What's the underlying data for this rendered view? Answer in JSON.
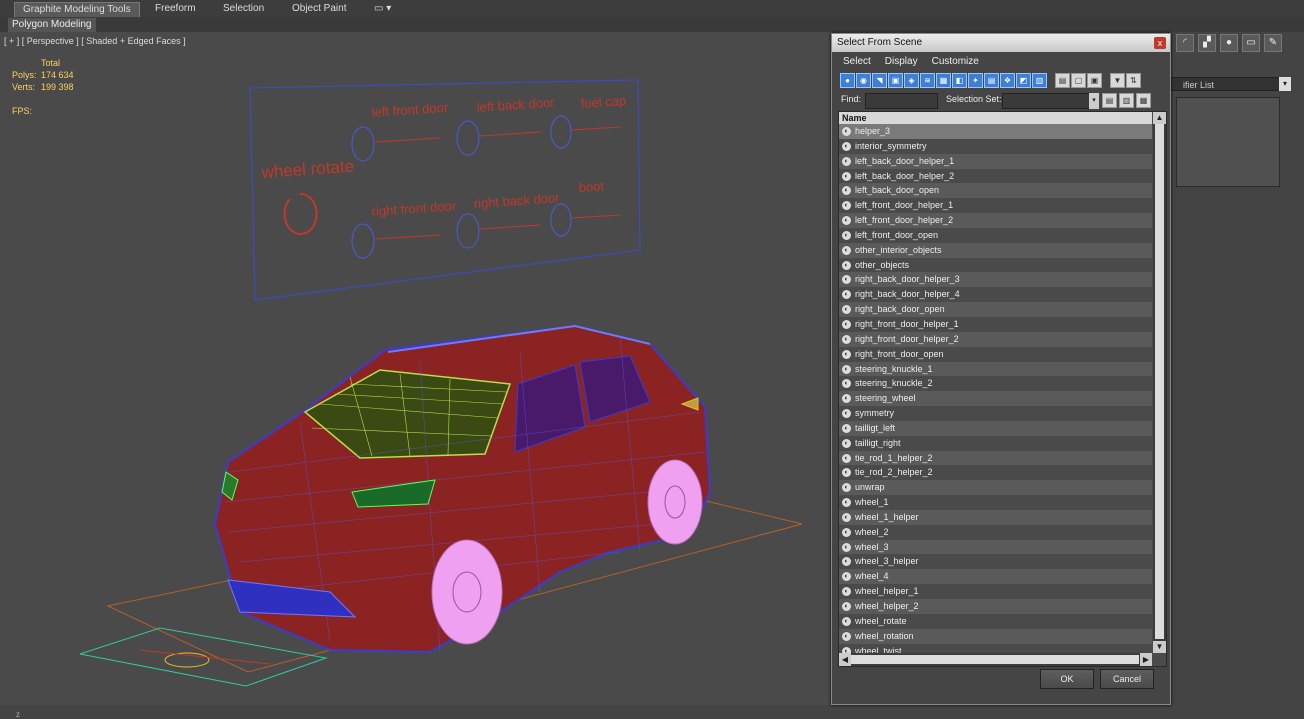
{
  "ribbon": {
    "tabs": [
      "Graphite Modeling Tools",
      "Freeform",
      "Selection",
      "Object Paint"
    ],
    "subtab": "Polygon Modeling"
  },
  "viewport": {
    "label": "[ + ] [ Perspective ] [ Shaded + Edged Faces ]",
    "stats": {
      "total_label": "Total",
      "polys_label": "Polys:",
      "polys": "174 634",
      "verts_label": "Verts:",
      "verts": "199 398",
      "fps_label": "FPS:"
    },
    "panel_labels": {
      "wheel_rotate": "wheel rotate",
      "left_front_door": "left front door",
      "left_back_door": "left back door",
      "fuel_cap": "fuel cap",
      "right_front_door": "right front door",
      "right_back_door": "right back door",
      "boot": "boot"
    },
    "accent_colors": {
      "label": "#c0392b",
      "wire": "#3b3bd1",
      "body": "#8b2323",
      "glass": "#b8e04a",
      "wheels": "#f0a0f0",
      "grid": "#c07030"
    }
  },
  "dialog": {
    "title": "Select From Scene",
    "close": "x",
    "menu": [
      "Select",
      "Display",
      "Customize"
    ],
    "find_label": "Find:",
    "find_value": "",
    "selection_set_label": "Selection Set:",
    "selection_set_value": "",
    "column_header": "Name",
    "items": [
      "helper_3",
      "interior_symmetry",
      "left_back_door_helper_1",
      "left_back_door_helper_2",
      "left_back_door_open",
      "left_front_door_helper_1",
      "left_front_door_helper_2",
      "left_front_door_open",
      "other_interior_objects",
      "other_objects",
      "right_back_door_helper_3",
      "right_back_door_helper_4",
      "right_back_door_open",
      "right_front_door_helper_1",
      "right_front_door_helper_2",
      "right_front_door_open",
      "steering_knuckle_1",
      "steering_knuckle_2",
      "steering_wheel",
      "symmetry",
      "tailligt_left",
      "tailligt_right",
      "tie_rod_1_helper_2",
      "tie_rod_2_helper_2",
      "unwrap",
      "wheel_1",
      "wheel_1_helper",
      "wheel_2",
      "wheel_3",
      "wheel_3_helper",
      "wheel_4",
      "wheel_helper_1",
      "wheel_helper_2",
      "wheel_rotate",
      "wheel_rotation",
      "wheel_twist"
    ],
    "selected_index": 0,
    "ok_label": "OK",
    "cancel_label": "Cancel"
  },
  "right_panel": {
    "modifier_list": "ifier List"
  },
  "icons": [
    "display-filter-icon",
    "hierarchy-icon",
    "motion-icon",
    "display-icon",
    "utilities-icon"
  ]
}
